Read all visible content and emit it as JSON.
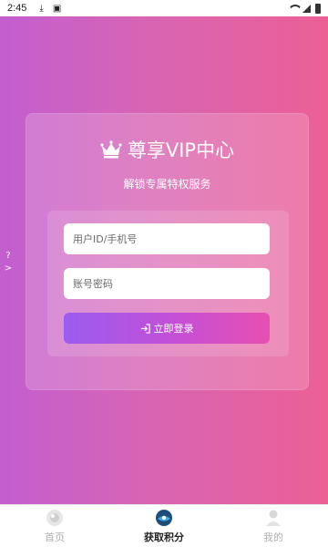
{
  "status_bar": {
    "time": "2:45"
  },
  "card": {
    "title": "尊享VIP中心",
    "subtitle": "解锁专属特权服务"
  },
  "form": {
    "user_placeholder": "用户ID/手机号",
    "password_placeholder": "账号密码",
    "login_label": "立即登录"
  },
  "side_hint": {
    "q": "?",
    "arrow": ">"
  },
  "bottom_nav": {
    "items": [
      {
        "label": "首页",
        "icon": "home-icon"
      },
      {
        "label": "获取积分",
        "icon": "points-icon",
        "active": true
      },
      {
        "label": "我的",
        "icon": "profile-icon"
      }
    ]
  },
  "colors": {
    "gradient_start": "#c35ed0",
    "gradient_end": "#ec5f95",
    "button_start": "#9a5cf0",
    "button_end": "#e84fb1"
  }
}
